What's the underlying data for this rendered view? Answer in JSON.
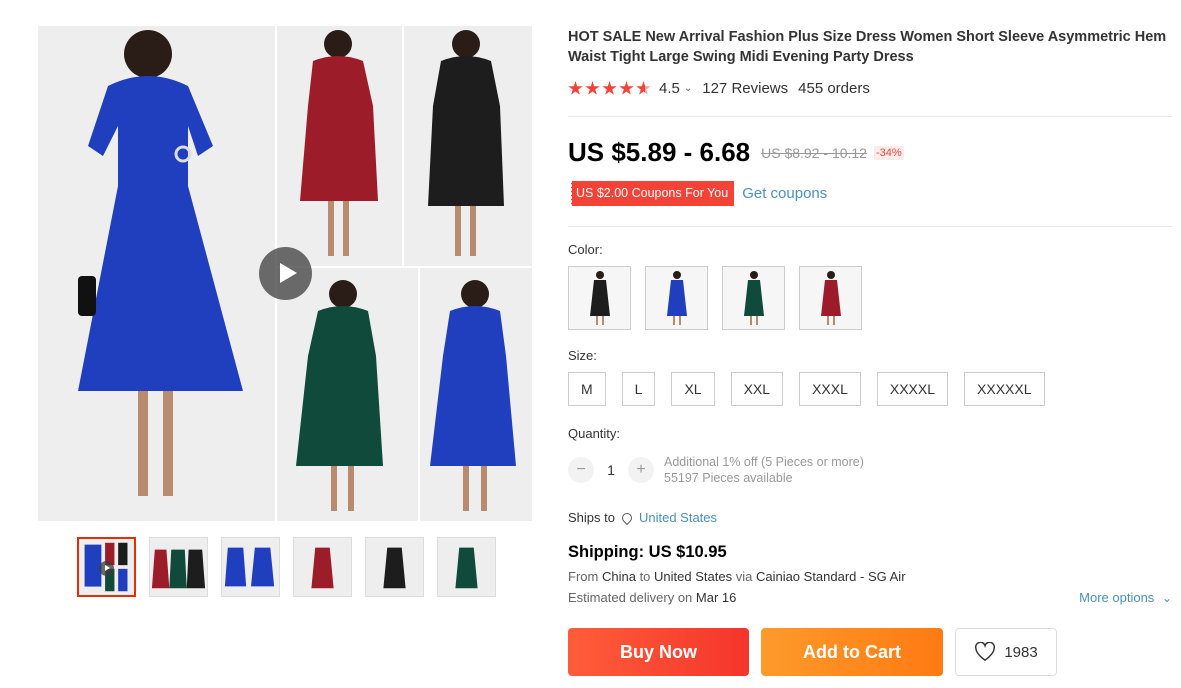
{
  "product": {
    "title": "HOT SALE New Arrival Fashion Plus Size Dress Women Short Sleeve Asymmetric Hem Waist Tight Large Swing Midi Evening Party Dress",
    "rating": "4.5",
    "rating_stars": 4.5,
    "reviews": "127 Reviews",
    "orders": "455 orders",
    "price": "US $5.89 - 6.68",
    "original_price": "US $8.92 - 10.12",
    "discount": "-34%",
    "coupon": "US $2.00 Coupons For You",
    "get_coupons": "Get coupons"
  },
  "options": {
    "color_label": "Color:",
    "colors": [
      {
        "name": "black",
        "hex": "#1d1d1d"
      },
      {
        "name": "royal blue",
        "hex": "#1f3fbf"
      },
      {
        "name": "dark green",
        "hex": "#0f4a3a"
      },
      {
        "name": "wine red",
        "hex": "#9c1c2a"
      }
    ],
    "size_label": "Size:",
    "sizes": [
      "M",
      "L",
      "XL",
      "XXL",
      "XXXL",
      "XXXXL",
      "XXXXXL"
    ],
    "quantity_label": "Quantity:",
    "quantity_minus": "−",
    "quantity": "1",
    "quantity_plus": "+",
    "quantity_discount": "Additional 1% off (5 Pieces or more)",
    "available": "55197 Pieces available"
  },
  "shipping": {
    "ships_to_label": "Ships to",
    "ships_to": "United States",
    "title": "Shipping: US $10.95",
    "from_label": "From",
    "from": "China",
    "to_label": "to",
    "to": "United States",
    "via_label": "via",
    "via": "Cainiao Standard - SG Air",
    "delivery_label": "Estimated delivery on",
    "delivery_date": "Mar 16",
    "more_options": "More options"
  },
  "actions": {
    "buy_now": "Buy Now",
    "add_to_cart": "Add to Cart",
    "wishlist_count": "1983"
  },
  "gallery": {
    "thumbnail_count": 6,
    "active_thumbnail": 0,
    "has_video": true
  },
  "colors": {
    "accent_red": "#f44336",
    "link_blue": "#4a90c2",
    "buy_now": "#f5352b",
    "add_to_cart": "#ff8a1e"
  }
}
